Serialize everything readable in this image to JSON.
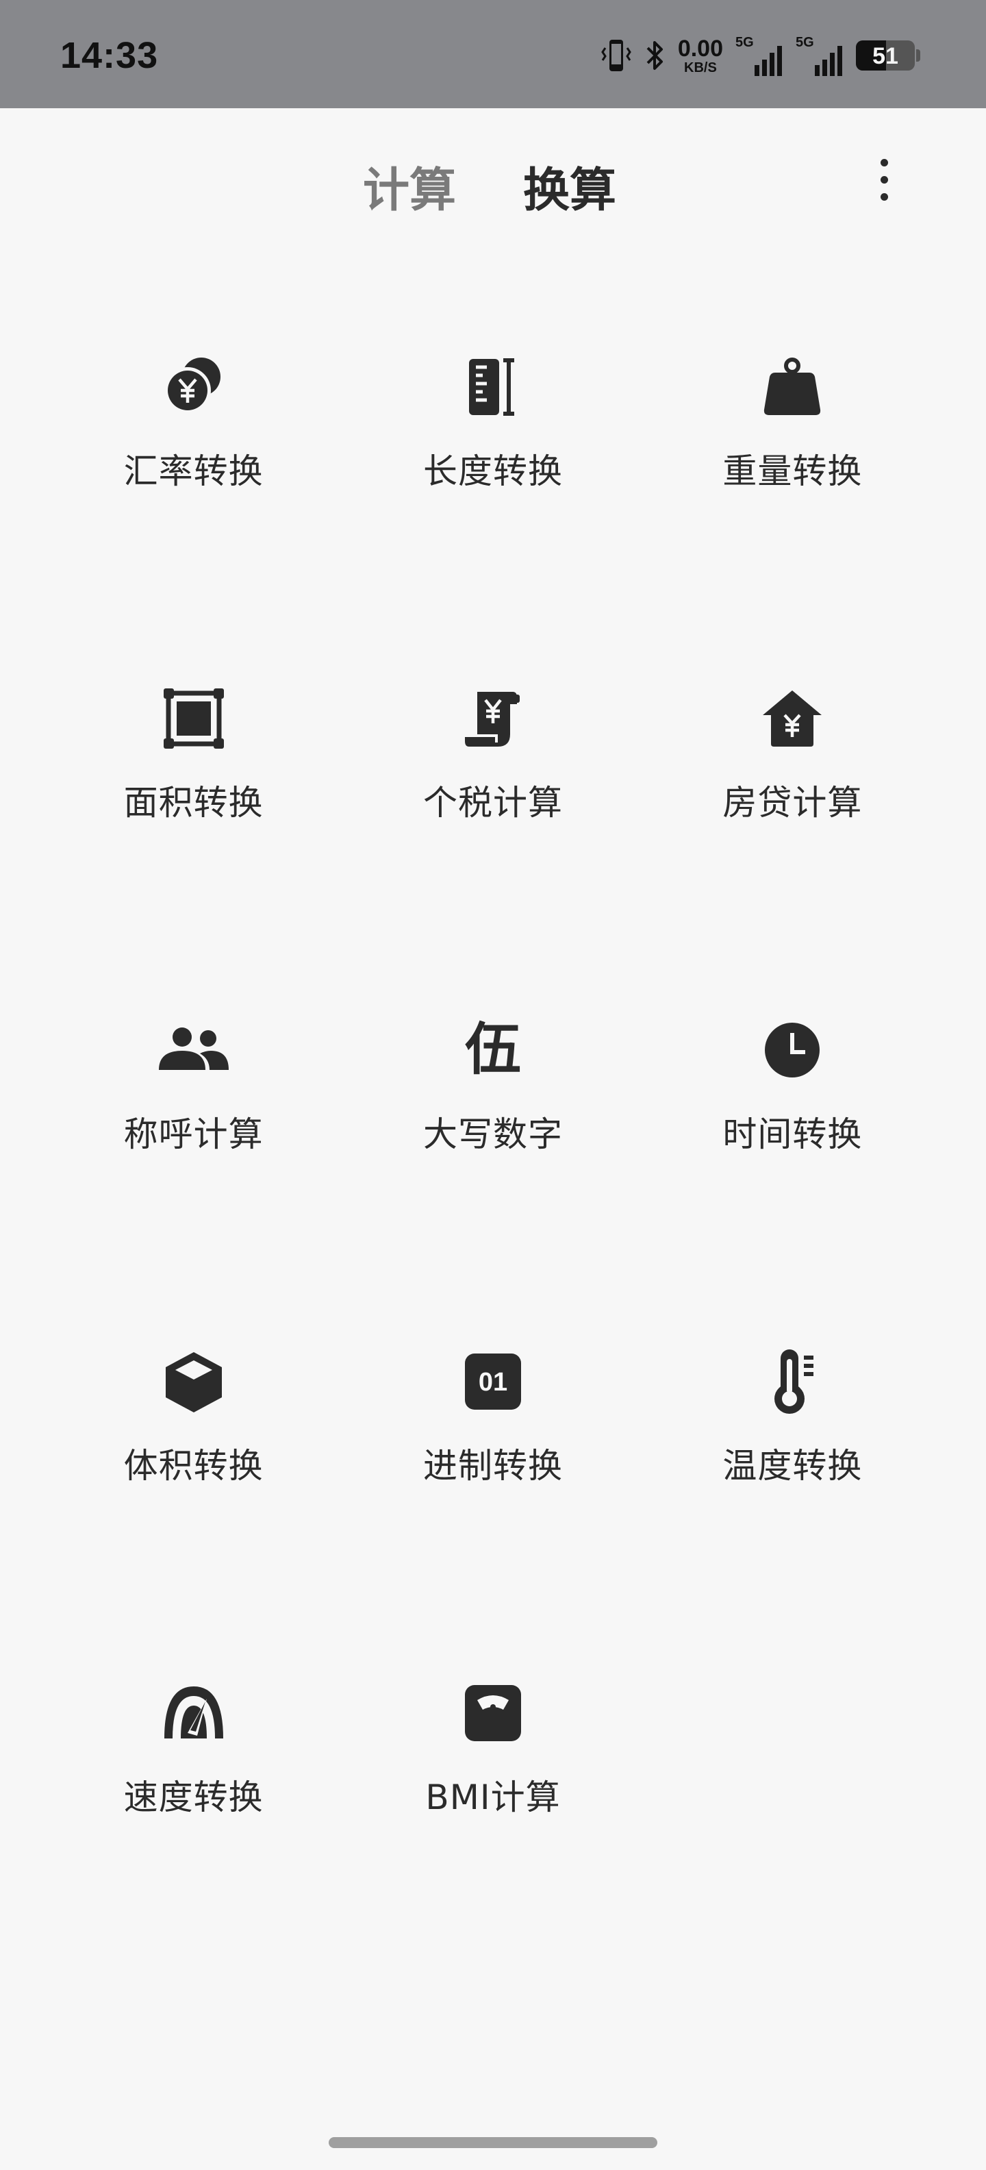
{
  "status_bar": {
    "time": "14:33",
    "net_speed_value": "0.00",
    "net_speed_unit": "KB/S",
    "sim1_tag": "5G",
    "sim2_tag": "5G",
    "battery_level": "51",
    "battery_fraction": 0.51
  },
  "header": {
    "tab_calc": "计算",
    "tab_convert": "换算",
    "active_tab": "换算",
    "menu_icon": "more-vertical-icon"
  },
  "tools": [
    {
      "label": "汇率转换",
      "icon": "currency-coins-icon"
    },
    {
      "label": "长度转换",
      "icon": "ruler-icon"
    },
    {
      "label": "重量转换",
      "icon": "weight-icon"
    },
    {
      "label": "面积转换",
      "icon": "area-square-icon"
    },
    {
      "label": "个税计算",
      "icon": "tax-receipt-icon"
    },
    {
      "label": "房贷计算",
      "icon": "mortgage-house-icon"
    },
    {
      "label": "称呼计算",
      "icon": "people-icon"
    },
    {
      "label": "大写数字",
      "icon": "wu-character-icon",
      "glyph": "伍"
    },
    {
      "label": "时间转换",
      "icon": "clock-icon"
    },
    {
      "label": "体积转换",
      "icon": "cube-icon"
    },
    {
      "label": "进制转换",
      "icon": "binary-icon",
      "glyph": "01"
    },
    {
      "label": "温度转换",
      "icon": "thermometer-icon"
    },
    {
      "label": "速度转换",
      "icon": "speedometer-icon"
    },
    {
      "label": "BMI计算",
      "icon": "bmi-scale-icon"
    }
  ],
  "colors": {
    "status_bar_bg": "#87888c",
    "page_bg": "#f7f7f7",
    "icon": "#2b2b2b",
    "tab_inactive": "#7a7a7a"
  }
}
